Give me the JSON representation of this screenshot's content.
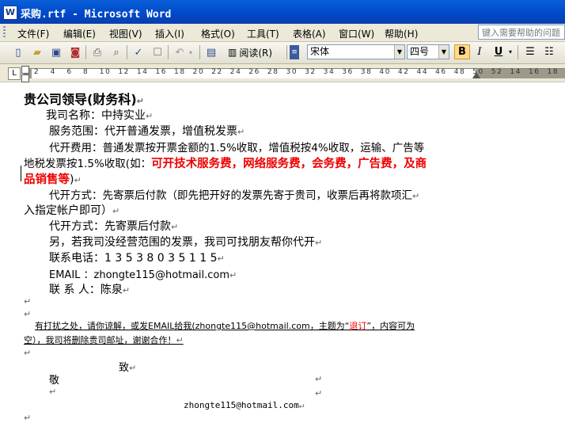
{
  "window": {
    "title": "采购.rtf - Microsoft Word"
  },
  "menubar": {
    "items": [
      "文件(F)",
      "编辑(E)",
      "视图(V)",
      "插入(I)",
      "格式(O)",
      "工具(T)",
      "表格(A)",
      "窗口(W)",
      "帮助(H)"
    ],
    "help_placeholder": "键入需要帮助的问题"
  },
  "toolbar": {
    "icons": [
      "new-icon",
      "open-icon",
      "save-icon",
      "permission-icon",
      "print-icon",
      "print-preview-icon",
      "spelling-icon",
      "research-icon",
      "undo-icon",
      "redo-icon",
      "document-map-icon"
    ],
    "read_label": "阅读(R)",
    "font_name": "宋体",
    "font_size": "四号",
    "bold_label": "B",
    "italic_label": "I",
    "underline_label": "U"
  },
  "ruler": {
    "numbers": "L  2 · 1 · · · 2 · 4 · 6 · 8 · 10 · 12 · 14 · 16 · 18 · 20 · 22 · 24 · 26 · 28 · 30 · 32 · 34 · 36 · 38 ·40· 42 44 46 48 50 · 52 · 14 · 16 · 18 · 16"
  },
  "document": {
    "heading": "贵公司领导(财务科)",
    "lines": [
      "我司名称：中持实业",
      "服务范围：代开普通发票，增值税发票",
      "代开费用：普通发票按开票金额的1.5%收取，增值税按4%收取，运输、广告等",
      "地税发票按1.5%收取(如：",
      "可开技术服务费，网络服务费，会务费，广告费，及商",
      "品销售等",
      ")",
      "代开方式：先寄票后付款（即先把开好的发票先寄于贵司，收票后再将款项汇",
      "入指定帐户即可）",
      "代开方式：先寄票后付款",
      "另，若我司没经营范围的发票，我司可找朋友帮你代开",
      "联系电话：1 3 5 3 8 0 3 5 1 1 5",
      "EMAIL    ：zhongte115@hotmail.com",
      "联 系 人：陈泉"
    ],
    "notice_part1": "有打扰之处，请你谅解，或发EMAIL给我(zhongte115@hotmail.com，主题为“",
    "notice_red": "退订",
    "notice_part2": "”，内容可为",
    "notice_line2": "空），我司将删除贵司邮址，谢谢合作！",
    "closing1": "致",
    "closing2": "敬",
    "signature": "zhongte115@hotmail.com",
    "para_mark": "↵"
  }
}
